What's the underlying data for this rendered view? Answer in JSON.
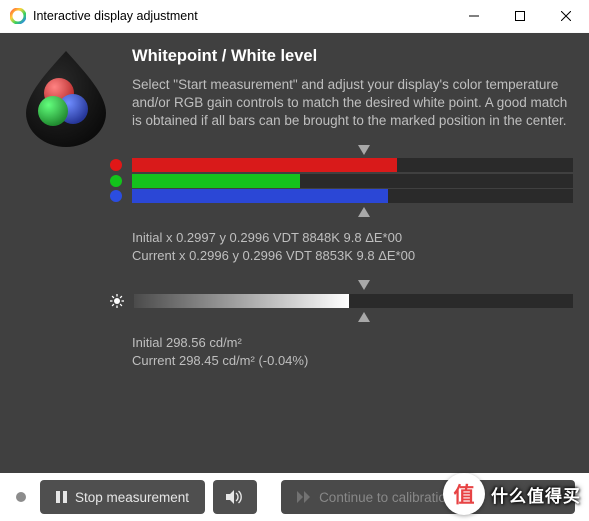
{
  "window": {
    "title": "Interactive display adjustment"
  },
  "header": "Whitepoint / White level",
  "body_text": "Select \"Start measurement\" and adjust your display's color temperature and/or RGB gain controls to match the desired white point. A good match is obtained if all bars can be brought to the marked position in the center.",
  "rgb_bars": {
    "red": {
      "color": "#e01717",
      "fill_color": "#d91a1a",
      "pct": 60
    },
    "green": {
      "color": "#12c41a",
      "fill_color": "#15c21d",
      "pct": 38
    },
    "blue": {
      "color": "#2b4de0",
      "fill_color": "#2b47d6",
      "pct": 58
    }
  },
  "whitepoint_stats": {
    "initial": "Initial x 0.2997 y 0.2996 VDT 8848K 9.8 ΔE*00",
    "current": "Current x 0.2996 y 0.2996 VDT 8853K 9.8 ΔE*00"
  },
  "brightness_bar": {
    "pct": 49
  },
  "luminance_stats": {
    "initial": "Initial 298.56 cd/m²",
    "current": "Current 298.45 cd/m² (-0.04%)"
  },
  "buttons": {
    "stop": "Stop measurement",
    "continue": "Continue to calibration"
  },
  "overlay": {
    "glyph": "值",
    "text": "什么值得买"
  }
}
